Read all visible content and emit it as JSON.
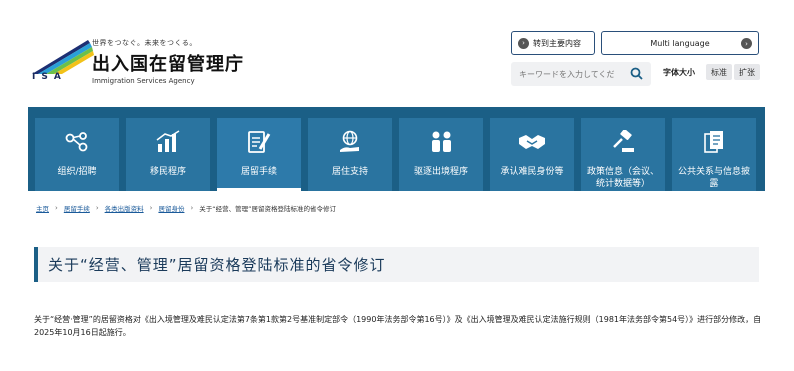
{
  "header": {
    "tagline": "世界をつなぐ。未来をつくる。",
    "agency_name": "出入国在留管理庁",
    "agency_en": "Immigration Services Agency",
    "logo_abbr": "ISA",
    "skip_button": "转到主要内容",
    "language_button": "Multi language",
    "search": {
      "placeholder": "キーワードを入力してくだ"
    },
    "font_size_label": "字体大小",
    "font_std": "标准",
    "font_big": "扩张"
  },
  "nav": {
    "items": [
      {
        "label": "组织/招聘",
        "icon": "network-icon"
      },
      {
        "label": "移民程序",
        "icon": "bar-chart-icon"
      },
      {
        "label": "居留手续",
        "icon": "document-pen-icon"
      },
      {
        "label": "居住支持",
        "icon": "globe-hand-icon"
      },
      {
        "label": "驱逐出境程序",
        "icon": "people-icon"
      },
      {
        "label": "承认难民身份等",
        "icon": "handshake-icon"
      },
      {
        "label": "政策信息（会议、统计数据等）",
        "icon": "gavel-icon"
      },
      {
        "label": "公共关系与信息披露",
        "icon": "documents-icon"
      }
    ]
  },
  "breadcrumb": {
    "items": [
      "主页",
      "居留手续",
      "各类出版资料",
      "居留身份"
    ],
    "current": "关于“经营、管理”居留资格登陆标准的省令修订"
  },
  "page": {
    "title": "关于“经营、管理”居留资格登陆标准的省令修订",
    "body": "关于“经营·管理”的居留资格对《出入境管理及难民认定法第7条第1款第2号基准制定部令（1990年法务部令第16号）》及《出入境管理及难民认定法施行规则（1981年法务部令第54号）》进行部分修改，自2025年10月16日起施行。"
  },
  "colors": {
    "nav_bg": "#1b5f86",
    "nav_item": "#2a74a0",
    "accent": "#1b5f86"
  }
}
